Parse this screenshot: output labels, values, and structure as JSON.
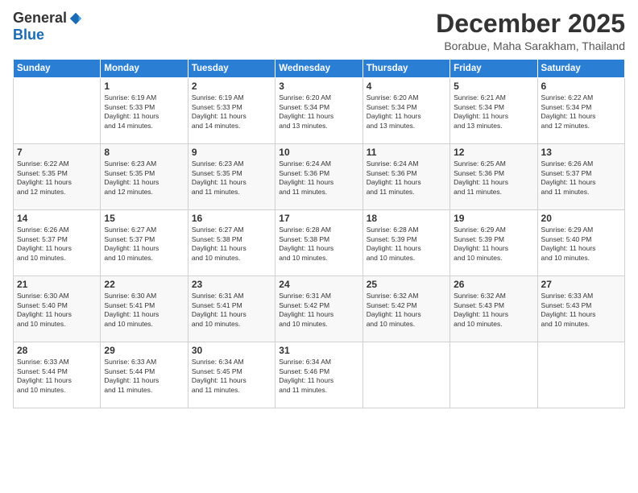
{
  "logo": {
    "general": "General",
    "blue": "Blue"
  },
  "title": "December 2025",
  "subtitle": "Borabue, Maha Sarakham, Thailand",
  "days_of_week": [
    "Sunday",
    "Monday",
    "Tuesday",
    "Wednesday",
    "Thursday",
    "Friday",
    "Saturday"
  ],
  "weeks": [
    [
      {
        "day": "",
        "info": ""
      },
      {
        "day": "1",
        "info": "Sunrise: 6:19 AM\nSunset: 5:33 PM\nDaylight: 11 hours\nand 14 minutes."
      },
      {
        "day": "2",
        "info": "Sunrise: 6:19 AM\nSunset: 5:33 PM\nDaylight: 11 hours\nand 14 minutes."
      },
      {
        "day": "3",
        "info": "Sunrise: 6:20 AM\nSunset: 5:34 PM\nDaylight: 11 hours\nand 13 minutes."
      },
      {
        "day": "4",
        "info": "Sunrise: 6:20 AM\nSunset: 5:34 PM\nDaylight: 11 hours\nand 13 minutes."
      },
      {
        "day": "5",
        "info": "Sunrise: 6:21 AM\nSunset: 5:34 PM\nDaylight: 11 hours\nand 13 minutes."
      },
      {
        "day": "6",
        "info": "Sunrise: 6:22 AM\nSunset: 5:34 PM\nDaylight: 11 hours\nand 12 minutes."
      }
    ],
    [
      {
        "day": "7",
        "info": "Sunrise: 6:22 AM\nSunset: 5:35 PM\nDaylight: 11 hours\nand 12 minutes."
      },
      {
        "day": "8",
        "info": "Sunrise: 6:23 AM\nSunset: 5:35 PM\nDaylight: 11 hours\nand 12 minutes."
      },
      {
        "day": "9",
        "info": "Sunrise: 6:23 AM\nSunset: 5:35 PM\nDaylight: 11 hours\nand 11 minutes."
      },
      {
        "day": "10",
        "info": "Sunrise: 6:24 AM\nSunset: 5:36 PM\nDaylight: 11 hours\nand 11 minutes."
      },
      {
        "day": "11",
        "info": "Sunrise: 6:24 AM\nSunset: 5:36 PM\nDaylight: 11 hours\nand 11 minutes."
      },
      {
        "day": "12",
        "info": "Sunrise: 6:25 AM\nSunset: 5:36 PM\nDaylight: 11 hours\nand 11 minutes."
      },
      {
        "day": "13",
        "info": "Sunrise: 6:26 AM\nSunset: 5:37 PM\nDaylight: 11 hours\nand 11 minutes."
      }
    ],
    [
      {
        "day": "14",
        "info": "Sunrise: 6:26 AM\nSunset: 5:37 PM\nDaylight: 11 hours\nand 10 minutes."
      },
      {
        "day": "15",
        "info": "Sunrise: 6:27 AM\nSunset: 5:37 PM\nDaylight: 11 hours\nand 10 minutes."
      },
      {
        "day": "16",
        "info": "Sunrise: 6:27 AM\nSunset: 5:38 PM\nDaylight: 11 hours\nand 10 minutes."
      },
      {
        "day": "17",
        "info": "Sunrise: 6:28 AM\nSunset: 5:38 PM\nDaylight: 11 hours\nand 10 minutes."
      },
      {
        "day": "18",
        "info": "Sunrise: 6:28 AM\nSunset: 5:39 PM\nDaylight: 11 hours\nand 10 minutes."
      },
      {
        "day": "19",
        "info": "Sunrise: 6:29 AM\nSunset: 5:39 PM\nDaylight: 11 hours\nand 10 minutes."
      },
      {
        "day": "20",
        "info": "Sunrise: 6:29 AM\nSunset: 5:40 PM\nDaylight: 11 hours\nand 10 minutes."
      }
    ],
    [
      {
        "day": "21",
        "info": "Sunrise: 6:30 AM\nSunset: 5:40 PM\nDaylight: 11 hours\nand 10 minutes."
      },
      {
        "day": "22",
        "info": "Sunrise: 6:30 AM\nSunset: 5:41 PM\nDaylight: 11 hours\nand 10 minutes."
      },
      {
        "day": "23",
        "info": "Sunrise: 6:31 AM\nSunset: 5:41 PM\nDaylight: 11 hours\nand 10 minutes."
      },
      {
        "day": "24",
        "info": "Sunrise: 6:31 AM\nSunset: 5:42 PM\nDaylight: 11 hours\nand 10 minutes."
      },
      {
        "day": "25",
        "info": "Sunrise: 6:32 AM\nSunset: 5:42 PM\nDaylight: 11 hours\nand 10 minutes."
      },
      {
        "day": "26",
        "info": "Sunrise: 6:32 AM\nSunset: 5:43 PM\nDaylight: 11 hours\nand 10 minutes."
      },
      {
        "day": "27",
        "info": "Sunrise: 6:33 AM\nSunset: 5:43 PM\nDaylight: 11 hours\nand 10 minutes."
      }
    ],
    [
      {
        "day": "28",
        "info": "Sunrise: 6:33 AM\nSunset: 5:44 PM\nDaylight: 11 hours\nand 10 minutes."
      },
      {
        "day": "29",
        "info": "Sunrise: 6:33 AM\nSunset: 5:44 PM\nDaylight: 11 hours\nand 11 minutes."
      },
      {
        "day": "30",
        "info": "Sunrise: 6:34 AM\nSunset: 5:45 PM\nDaylight: 11 hours\nand 11 minutes."
      },
      {
        "day": "31",
        "info": "Sunrise: 6:34 AM\nSunset: 5:46 PM\nDaylight: 11 hours\nand 11 minutes."
      },
      {
        "day": "",
        "info": ""
      },
      {
        "day": "",
        "info": ""
      },
      {
        "day": "",
        "info": ""
      }
    ]
  ]
}
